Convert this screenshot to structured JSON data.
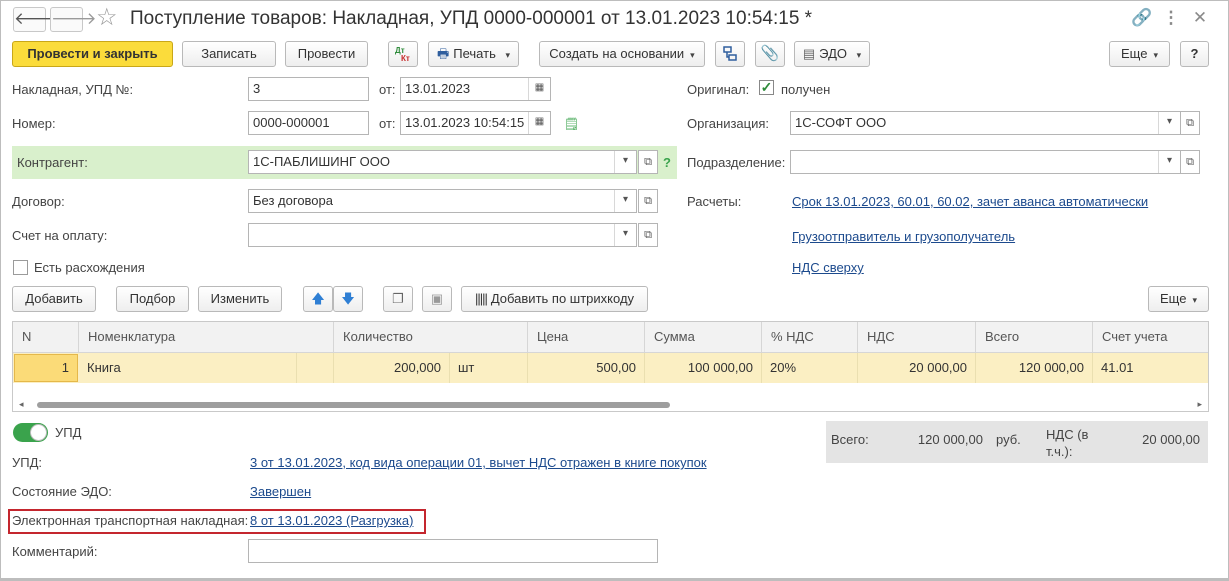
{
  "window": {
    "title": "Поступление товаров: Накладная, УПД 0000-000001 от 13.01.2023 10:54:15 *"
  },
  "toolbar": {
    "post_close": "Провести и закрыть",
    "save": "Записать",
    "post": "Провести",
    "dt_kt": "Дт Кт",
    "print": "Печать",
    "create_based": "Создать на основании",
    "edo": "ЭДО",
    "more": "Еще",
    "help": "?"
  },
  "form": {
    "invoice_label": "Накладная, УПД №:",
    "invoice_value": "3",
    "from_label": "от:",
    "invoice_date": "13.01.2023",
    "number_label": "Номер:",
    "number_value": "0000-000001",
    "number_date": "13.01.2023 10:54:15",
    "counterparty_label": "Контрагент:",
    "counterparty_value": "1С-ПАБЛИШИНГ ООО",
    "counterparty_help": "?",
    "contract_label": "Договор:",
    "contract_value": "Без договора",
    "payment_invoice_label": "Счет на оплату:",
    "payment_invoice_value": "",
    "discrepancy_label": "Есть расхождения",
    "original_label": "Оригинал:",
    "original_value": "получен",
    "org_label": "Организация:",
    "org_value": "1С-СОФТ ООО",
    "division_label": "Подразделение:",
    "division_value": "",
    "settlements_label": "Расчеты:",
    "settlements_link": "Срок 13.01.2023, 60.01, 60.02, зачет аванса автоматически",
    "shipper_link": "Грузоотправитель и грузополучатель",
    "vat_link": "НДС сверху"
  },
  "table_toolbar": {
    "add": "Добавить",
    "select": "Подбор",
    "change": "Изменить",
    "add_barcode": "Добавить по штрихкоду",
    "more": "Еще"
  },
  "table": {
    "columns": [
      "N",
      "Номенклатура",
      "Количество",
      "Цена",
      "Сумма",
      "% НДС",
      "НДС",
      "Всего",
      "Счет учета"
    ],
    "rows": [
      {
        "n": "1",
        "item": "Книга",
        "qty": "200,000",
        "unit": "шт",
        "price": "500,00",
        "sum": "100 000,00",
        "vat_rate": "20%",
        "vat": "20 000,00",
        "total": "120 000,00",
        "account": "41.01"
      }
    ]
  },
  "totals": {
    "total_label": "Всего:",
    "total_value": "120 000,00",
    "currency": "руб.",
    "vat_label_1": "НДС (в",
    "vat_label_2": "т.ч.):",
    "vat_value": "20 000,00"
  },
  "bottom": {
    "upd_toggle_label": "УПД",
    "upd_label": "УПД:",
    "upd_link": "3 от 13.01.2023, код вида операции 01, вычет НДС отражен в книге покупок",
    "edo_state_label": "Состояние ЭДО:",
    "edo_state_link": "Завершен",
    "etn_label": "Электронная транспортная накладная:",
    "etn_link": "8 от 13.01.2023 (Разгрузка)",
    "comment_label": "Комментарий:",
    "comment_value": ""
  },
  "colors": {
    "primary_button": "#fbdc3b",
    "counterparty_highlight": "#d9f0cc",
    "selected_row": "#fbefc3",
    "link": "#1c4a8d",
    "highlight_box": "#c4262e",
    "toggle_on": "#3aa34c"
  }
}
